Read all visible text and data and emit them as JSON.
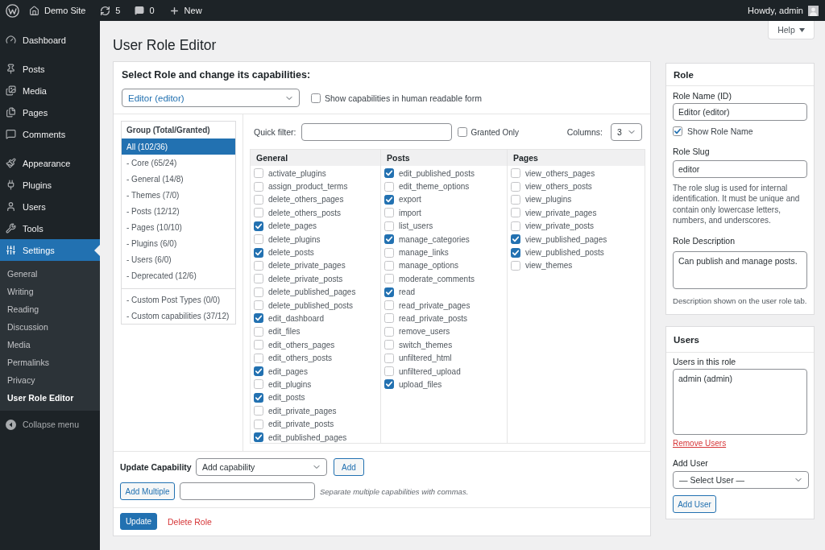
{
  "admin_bar": {
    "site_name": "Demo Site",
    "updates": "5",
    "comments": "0",
    "new_label": "New",
    "greeting": "Howdy, admin"
  },
  "sidebar": {
    "menu_groups": [
      {
        "items": [
          {
            "label": "Dashboard",
            "selected": false
          }
        ]
      },
      {
        "items": [
          {
            "label": "Posts",
            "selected": false
          },
          {
            "label": "Media",
            "selected": false
          },
          {
            "label": "Pages",
            "selected": false
          },
          {
            "label": "Comments",
            "selected": false
          }
        ]
      },
      {
        "items": [
          {
            "label": "Appearance",
            "selected": false
          },
          {
            "label": "Plugins",
            "selected": false
          },
          {
            "label": "Users",
            "selected": false
          },
          {
            "label": "Tools",
            "selected": false
          },
          {
            "label": "Settings",
            "selected": true
          }
        ]
      }
    ],
    "submenu": [
      {
        "label": "General",
        "selected": false
      },
      {
        "label": "Writing",
        "selected": false
      },
      {
        "label": "Reading",
        "selected": false
      },
      {
        "label": "Discussion",
        "selected": false
      },
      {
        "label": "Media",
        "selected": false
      },
      {
        "label": "Permalinks",
        "selected": false
      },
      {
        "label": "Privacy",
        "selected": false
      },
      {
        "label": "User Role Editor",
        "selected": true
      }
    ],
    "collapse_label": "Collapse menu"
  },
  "help_button": "Help",
  "page_title": "User Role Editor",
  "capabilities_panel": {
    "heading": "Select Role and change its capabilities:",
    "role_select": "Editor (editor)",
    "human_readable": {
      "label": "Show capabilities in human readable form",
      "checked": false
    },
    "groups": {
      "heading": "Group (Total/Granted)",
      "items": [
        {
          "label": "All (102/36)",
          "selected": true
        },
        {
          "label": "- Core (65/24)",
          "selected": false
        },
        {
          "label": "- General (14/8)",
          "selected": false
        },
        {
          "label": "- Themes (7/0)",
          "selected": false
        },
        {
          "label": "- Posts (12/12)",
          "selected": false
        },
        {
          "label": "- Pages (10/10)",
          "selected": false
        },
        {
          "label": "- Plugins (6/0)",
          "selected": false
        },
        {
          "label": "- Users (6/0)",
          "selected": false
        },
        {
          "label": "- Deprecated (12/6)",
          "selected": false
        }
      ],
      "custom_items": [
        {
          "label": "- Custom Post Types (0/0)",
          "selected": false
        },
        {
          "label": "- Custom capabilities (37/12)",
          "selected": false
        }
      ]
    },
    "quick_filter_label": "Quick filter:",
    "granted_only": {
      "label": "Granted Only",
      "checked": false
    },
    "columns_label": "Columns:",
    "columns_value": "3",
    "capability_columns": [
      {
        "title": "General",
        "items": [
          {
            "name": "activate_plugins",
            "checked": false
          },
          {
            "name": "assign_product_terms",
            "checked": false
          },
          {
            "name": "delete_others_pages",
            "checked": false
          },
          {
            "name": "delete_others_posts",
            "checked": false
          },
          {
            "name": "delete_pages",
            "checked": true
          },
          {
            "name": "delete_plugins",
            "checked": false
          },
          {
            "name": "delete_posts",
            "checked": true
          },
          {
            "name": "delete_private_pages",
            "checked": false
          },
          {
            "name": "delete_private_posts",
            "checked": false
          },
          {
            "name": "delete_published_pages",
            "checked": false
          },
          {
            "name": "delete_published_posts",
            "checked": false
          },
          {
            "name": "edit_dashboard",
            "checked": true
          },
          {
            "name": "edit_files",
            "checked": false
          },
          {
            "name": "edit_others_pages",
            "checked": false
          },
          {
            "name": "edit_others_posts",
            "checked": false
          },
          {
            "name": "edit_pages",
            "checked": true
          },
          {
            "name": "edit_plugins",
            "checked": false
          },
          {
            "name": "edit_posts",
            "checked": true
          },
          {
            "name": "edit_private_pages",
            "checked": false
          },
          {
            "name": "edit_private_posts",
            "checked": false
          },
          {
            "name": "edit_published_pages",
            "checked": true
          }
        ]
      },
      {
        "title": "Posts",
        "items": [
          {
            "name": "edit_published_posts",
            "checked": true
          },
          {
            "name": "edit_theme_options",
            "checked": false
          },
          {
            "name": "export",
            "checked": true
          },
          {
            "name": "import",
            "checked": false
          },
          {
            "name": "list_users",
            "checked": false
          },
          {
            "name": "manage_categories",
            "checked": true
          },
          {
            "name": "manage_links",
            "checked": false
          },
          {
            "name": "manage_options",
            "checked": false
          },
          {
            "name": "moderate_comments",
            "checked": false
          },
          {
            "name": "read",
            "checked": true
          },
          {
            "name": "read_private_pages",
            "checked": false
          },
          {
            "name": "read_private_posts",
            "checked": false
          },
          {
            "name": "remove_users",
            "checked": false
          },
          {
            "name": "switch_themes",
            "checked": false
          },
          {
            "name": "unfiltered_html",
            "checked": false
          },
          {
            "name": "unfiltered_upload",
            "checked": false
          },
          {
            "name": "upload_files",
            "checked": true
          }
        ]
      },
      {
        "title": "Pages",
        "items": [
          {
            "name": "view_others_pages",
            "checked": false
          },
          {
            "name": "view_others_posts",
            "checked": false
          },
          {
            "name": "view_plugins",
            "checked": false
          },
          {
            "name": "view_private_pages",
            "checked": false
          },
          {
            "name": "view_private_posts",
            "checked": false
          },
          {
            "name": "view_published_pages",
            "checked": true
          },
          {
            "name": "view_published_posts",
            "checked": true
          },
          {
            "name": "view_themes",
            "checked": false
          }
        ]
      }
    ],
    "update_capability": {
      "label": "Update Capability",
      "select_value": "Add capability",
      "add_button": "Add",
      "add_multiple_button": "Add Multiple",
      "hint": "Separate multiple capabilities with commas."
    },
    "update_button": "Update",
    "delete_link": "Delete Role"
  },
  "role_panel": {
    "title": "Role",
    "name_label": "Role Name (ID)",
    "name_value": "Editor (editor)",
    "show_name": {
      "label": "Show Role Name",
      "checked": true
    },
    "slug_label": "Role Slug",
    "slug_value": "editor",
    "slug_help": "The role slug is used for internal identification. It must be unique and contain only lowercase letters, numbers, and underscores.",
    "description_label": "Role Description",
    "description_value": "Can publish and manage posts.",
    "description_help": "Description shown on the user role tab."
  },
  "users_panel": {
    "title": "Users",
    "list_label": "Users in this role",
    "users": [
      {
        "name": "admin (admin)",
        "selected": false
      }
    ],
    "remove_link": "Remove Users",
    "add_label": "Add User",
    "select_value": "— Select User —",
    "add_button": "Add User"
  }
}
